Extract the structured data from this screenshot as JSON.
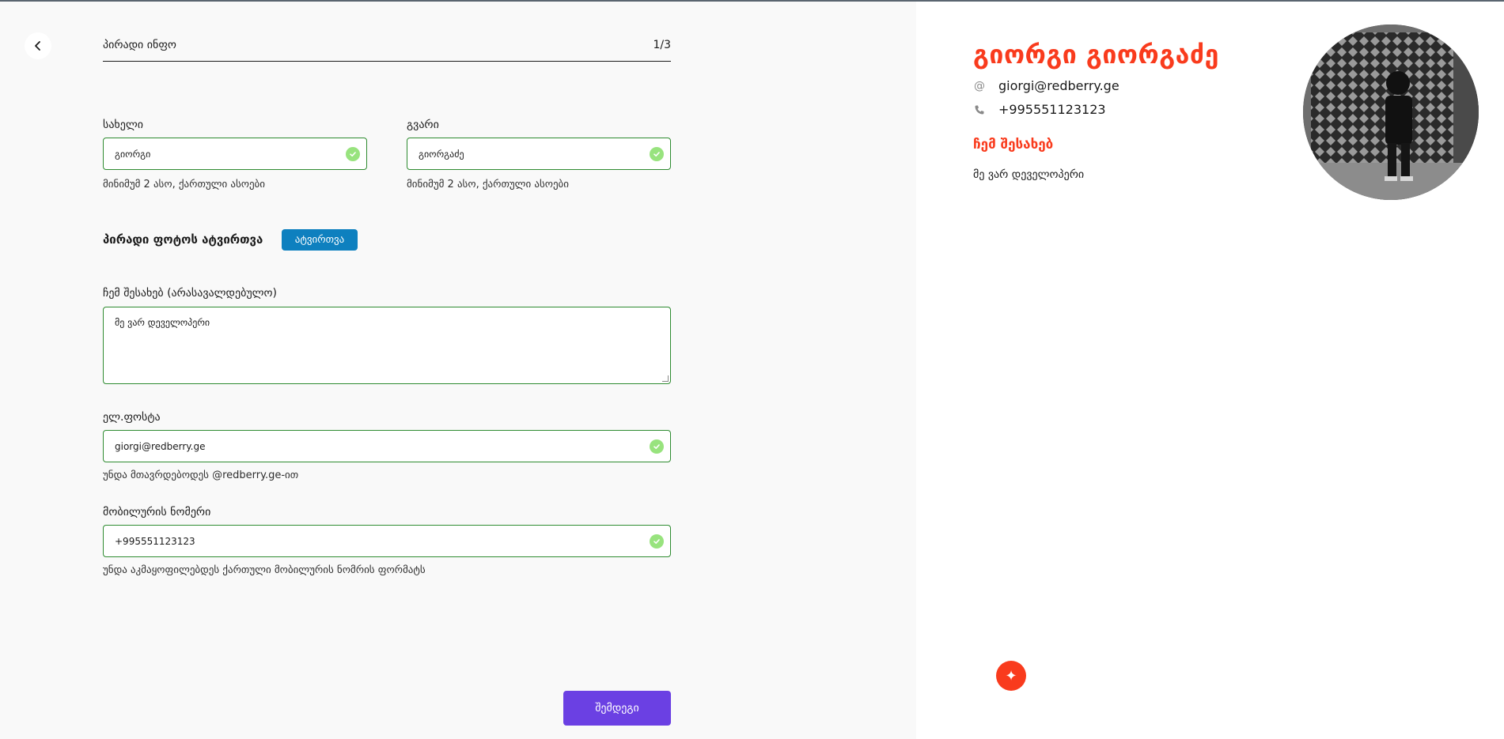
{
  "form": {
    "section_title": "პირადი ინფო",
    "step": "1/3",
    "first_name": {
      "label": "სახელი",
      "value": "გიორგი",
      "hint": "მინიმუმ 2 ასო, ქართული ასოები"
    },
    "last_name": {
      "label": "გვარი",
      "value": "გიორგაძე",
      "hint": "მინიმუმ 2 ასო, ქართული ასოები"
    },
    "photo": {
      "label": "პირადი ფოტოს ატვირთვა",
      "button": "ატვირთვა"
    },
    "about": {
      "label": "ჩემ შესახებ (არასავალდებულო)",
      "value": "მე ვარ დეველოპერი"
    },
    "email": {
      "label": "ელ.ფოსტა",
      "value": "giorgi@redberry.ge",
      "hint": "უნდა მთავრდებოდეს @redberry.ge-ით"
    },
    "phone": {
      "label": "მობილურის ნომერი",
      "value": "+995551123123",
      "hint": "უნდა აკმაყოფილებდეს ქართული მობილურის ნომრის ფორმატს"
    },
    "next_button": "შემდეგი"
  },
  "preview": {
    "name": "გიორგი გიორგაძე",
    "email": "giorgi@redberry.ge",
    "phone": "+995551123123",
    "about_heading": "ჩემ შესახებ",
    "about_text": "მე ვარ დეველოპერი"
  },
  "icons": {
    "back": "chevron-left-icon",
    "valid": "check-circle-icon",
    "email": "at-sign-icon",
    "phone": "phone-icon",
    "logo": "sparkle-icon"
  },
  "colors": {
    "accent_red": "#f93b1d",
    "valid_green": "#98e37e",
    "border_green": "#2e8b30",
    "upload_blue": "#0e80bf",
    "next_purple": "#6b40e3"
  }
}
